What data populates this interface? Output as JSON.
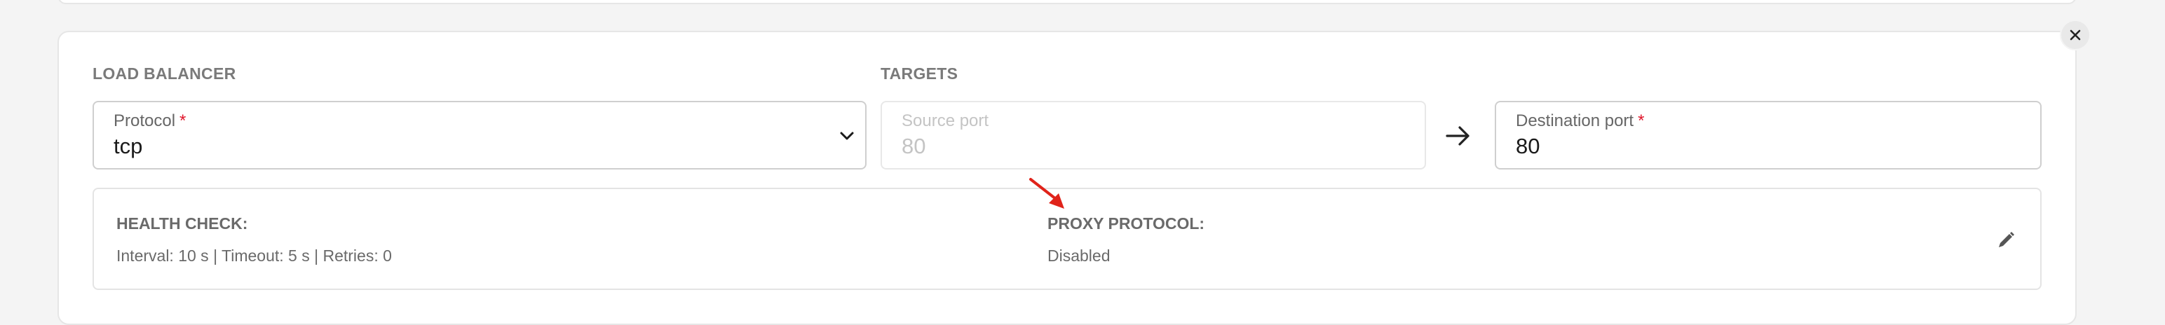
{
  "load_balancer": {
    "section_label": "LOAD BALANCER",
    "protocol": {
      "label": "Protocol",
      "required_mark": "*",
      "value": "tcp"
    }
  },
  "targets": {
    "section_label": "TARGETS",
    "source_port": {
      "label": "Source port",
      "value": "80",
      "disabled": true
    },
    "destination_port": {
      "label": "Destination port",
      "required_mark": "*",
      "value": "80"
    }
  },
  "health_check": {
    "title": "HEALTH CHECK:",
    "summary": "Interval: 10 s | Timeout: 5 s | Retries: 0"
  },
  "proxy_protocol": {
    "title": "PROXY PROTOCOL:",
    "status": "Disabled"
  },
  "icons": {
    "close": "close-icon",
    "chevron": "chevron-down-icon",
    "arrow": "arrow-right-icon",
    "edit": "pencil-icon",
    "annotation": "red-arrow-annotation"
  },
  "colors": {
    "required": "#e0162b",
    "annotation": "#e0231a"
  }
}
